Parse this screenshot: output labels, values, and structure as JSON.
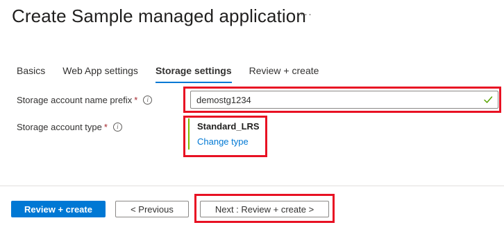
{
  "header": {
    "title": "Create Sample managed application",
    "more_label": "···"
  },
  "tabs": [
    {
      "label": "Basics"
    },
    {
      "label": "Web App settings"
    },
    {
      "label": "Storage settings",
      "active": true
    },
    {
      "label": "Review + create"
    }
  ],
  "form": {
    "prefix": {
      "label": "Storage account name prefix",
      "required_mark": "*",
      "info_glyph": "i",
      "value": "demostg1234",
      "valid": true
    },
    "type": {
      "label": "Storage account type",
      "required_mark": "*",
      "info_glyph": "i",
      "value": "Standard_LRS",
      "change_link": "Change type"
    }
  },
  "footer": {
    "review_create": "Review + create",
    "previous": "< Previous",
    "next": "Next : Review + create >"
  },
  "colors": {
    "accent": "#0078d4",
    "highlight": "#e81123",
    "valid": "#57a300",
    "selected_bar": "#7fba00",
    "required": "#a4262c"
  }
}
